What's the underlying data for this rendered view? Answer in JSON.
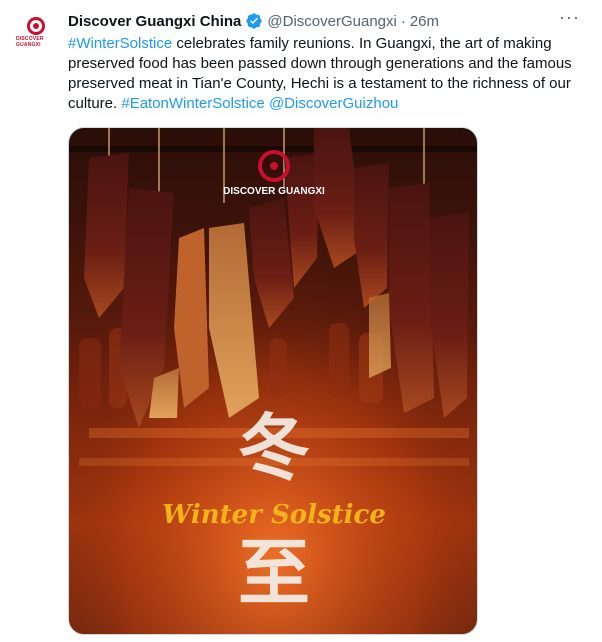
{
  "tweet": {
    "name": "Discover Guangxi China",
    "handle": "@DiscoverGuangxi",
    "separator": "·",
    "time": "26m",
    "more": "···",
    "avatar_text": "DISCOVER GUANGXI",
    "text_segments": [
      {
        "text": "#WinterSolstice",
        "link": true
      },
      {
        "text": " celebrates family reunions. In Guangxi, the art of making preserved food has been passed down through generations and the famous preserved meat in Tian'e County, Hechi is a testament to the richness of our culture. ",
        "link": false
      },
      {
        "text": "#EatonWinterSolstice",
        "link": true
      },
      {
        "text": " ",
        "link": false
      },
      {
        "text": "@DiscoverGuizhou",
        "link": true
      }
    ],
    "media": {
      "logo_text": "DISCOVER GUANGXI",
      "title_en": "Winter Solstice",
      "title_cn": "冬至"
    }
  },
  "colors": {
    "link": "#1d9bf0",
    "text": "#0f1419",
    "muted": "#536471",
    "verified": "#1d9bf0",
    "brand": "#c8102e",
    "title_gold": "#f2b21b"
  },
  "icons": [
    "verified-badge-icon",
    "more-icon",
    "brand-logo"
  ]
}
